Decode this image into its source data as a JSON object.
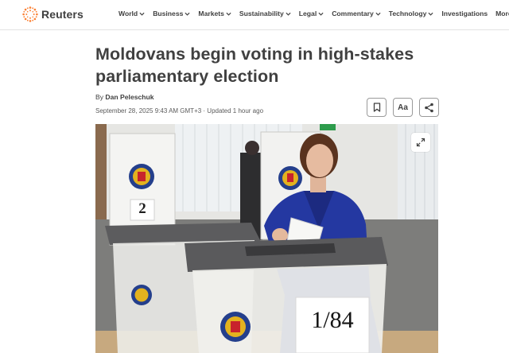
{
  "header": {
    "brand": "Reuters",
    "brand_color": "#fb8033",
    "nav": [
      {
        "label": "World",
        "has_menu": true
      },
      {
        "label": "Business",
        "has_menu": true
      },
      {
        "label": "Markets",
        "has_menu": true
      },
      {
        "label": "Sustainability",
        "has_menu": true
      },
      {
        "label": "Legal",
        "has_menu": true
      },
      {
        "label": "Commentary",
        "has_menu": true
      },
      {
        "label": "Technology",
        "has_menu": true
      },
      {
        "label": "Investigations",
        "has_menu": false
      },
      {
        "label": "More",
        "has_menu": true
      }
    ]
  },
  "article": {
    "headline": "Moldovans begin voting in high-stakes parliamentary election",
    "byline_prefix": "By",
    "author": "Dan Peleschuk",
    "dateline": "September 28, 2025 9:43 AM GMT+3 · Updated 1 hour ago",
    "tools": {
      "bookmark_icon": "bookmark-icon",
      "text_size_label": "Aa",
      "share_icon": "share-icon"
    },
    "photo": {
      "booth_number": "2",
      "ballot_box_number": "1/84",
      "expand_icon": "expand-icon"
    }
  }
}
